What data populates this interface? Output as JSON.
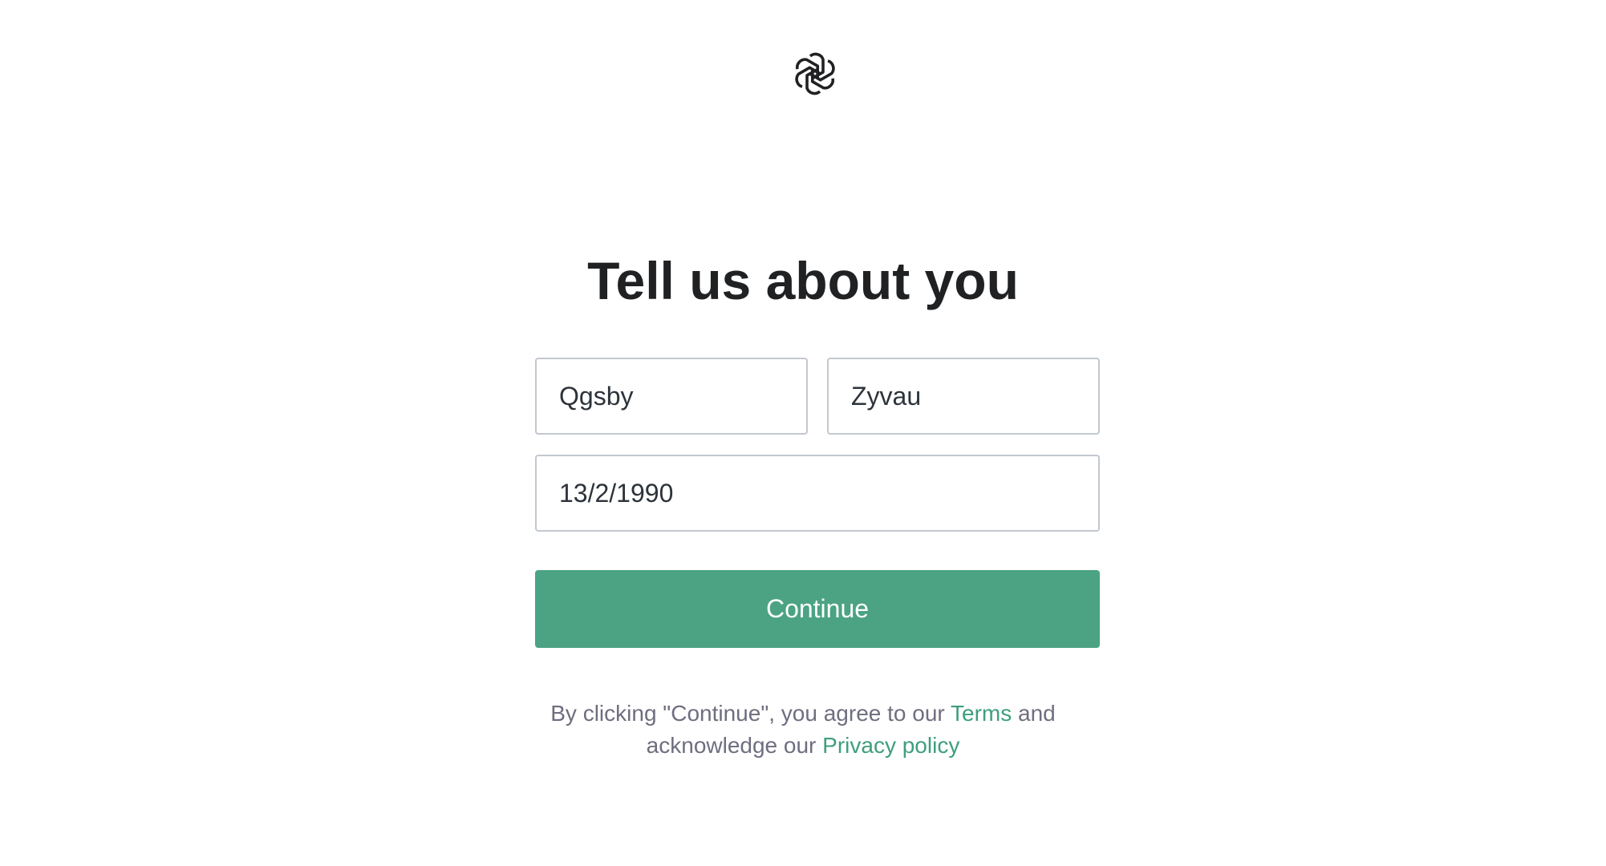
{
  "logo": {
    "icon": "openai-logo-icon"
  },
  "page": {
    "title": "Tell us about you"
  },
  "form": {
    "first_name_value": "Qgsby",
    "last_name_value": "Zyvau",
    "birthday_value": "13/2/1990",
    "continue_label": "Continue"
  },
  "legal": {
    "prefix": "By clicking \"Continue\", you agree to our ",
    "terms_label": "Terms",
    "middle": " and",
    "line2_prefix": "acknowledge our ",
    "privacy_label": "Privacy policy"
  },
  "colors": {
    "accent": "#4ba384",
    "link": "#3e9f7c",
    "border": "#c2c8d0",
    "text": "#202123",
    "muted": "#6e6e80"
  }
}
